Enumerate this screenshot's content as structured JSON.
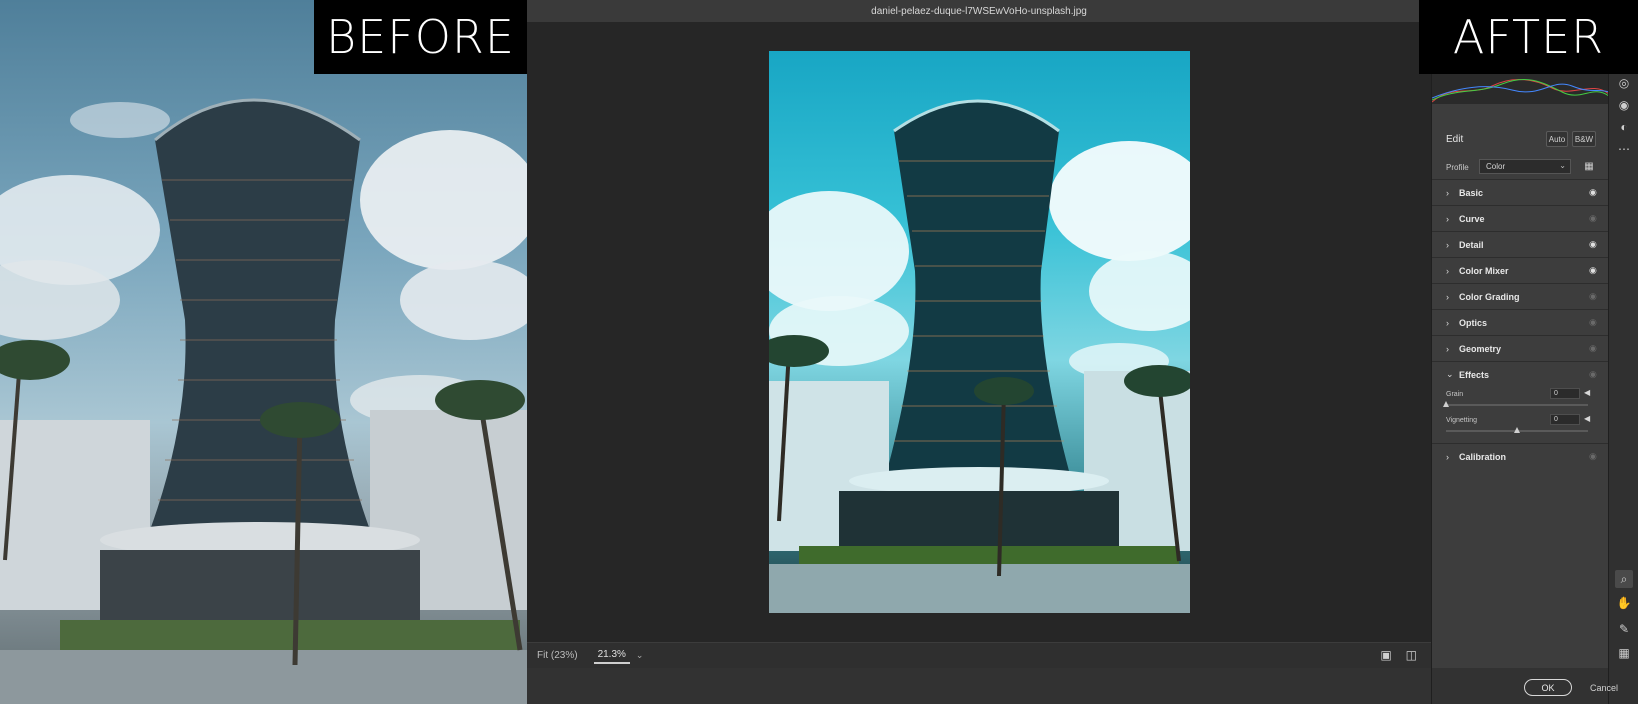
{
  "before_label": "BEFORE",
  "after_label": "AFTER",
  "window": {
    "title": "daniel-pelaez-duque-l7WSEwVoHo-unsplash.jpg"
  },
  "zoom": {
    "fit_label": "Fit (23%)",
    "value": "21.3%"
  },
  "panel": {
    "edit_title": "Edit",
    "auto_label": "Auto",
    "bw_label": "B&W",
    "profile_label": "Profile",
    "profile_value": "Color",
    "sections": [
      {
        "name": "Basic",
        "expanded": false,
        "visible": true
      },
      {
        "name": "Curve",
        "expanded": false,
        "visible": false
      },
      {
        "name": "Detail",
        "expanded": false,
        "visible": true
      },
      {
        "name": "Color Mixer",
        "expanded": false,
        "visible": true
      },
      {
        "name": "Color Grading",
        "expanded": false,
        "visible": false
      },
      {
        "name": "Optics",
        "expanded": false,
        "visible": false
      },
      {
        "name": "Geometry",
        "expanded": false,
        "visible": false
      },
      {
        "name": "Effects",
        "expanded": true,
        "visible": false
      },
      {
        "name": "Calibration",
        "expanded": false,
        "visible": false
      }
    ],
    "effects": {
      "grain": {
        "label": "Grain",
        "value": "0",
        "position": 0.0
      },
      "vignetting": {
        "label": "Vignetting",
        "value": "0",
        "position": 0.5
      }
    }
  },
  "actions": {
    "ok_label": "OK",
    "cancel_label": "Cancel"
  },
  "icons": {
    "expand_collapsed": "chevron-right-icon",
    "expand_open": "chevron-down-icon",
    "visibility": "eye-icon"
  }
}
